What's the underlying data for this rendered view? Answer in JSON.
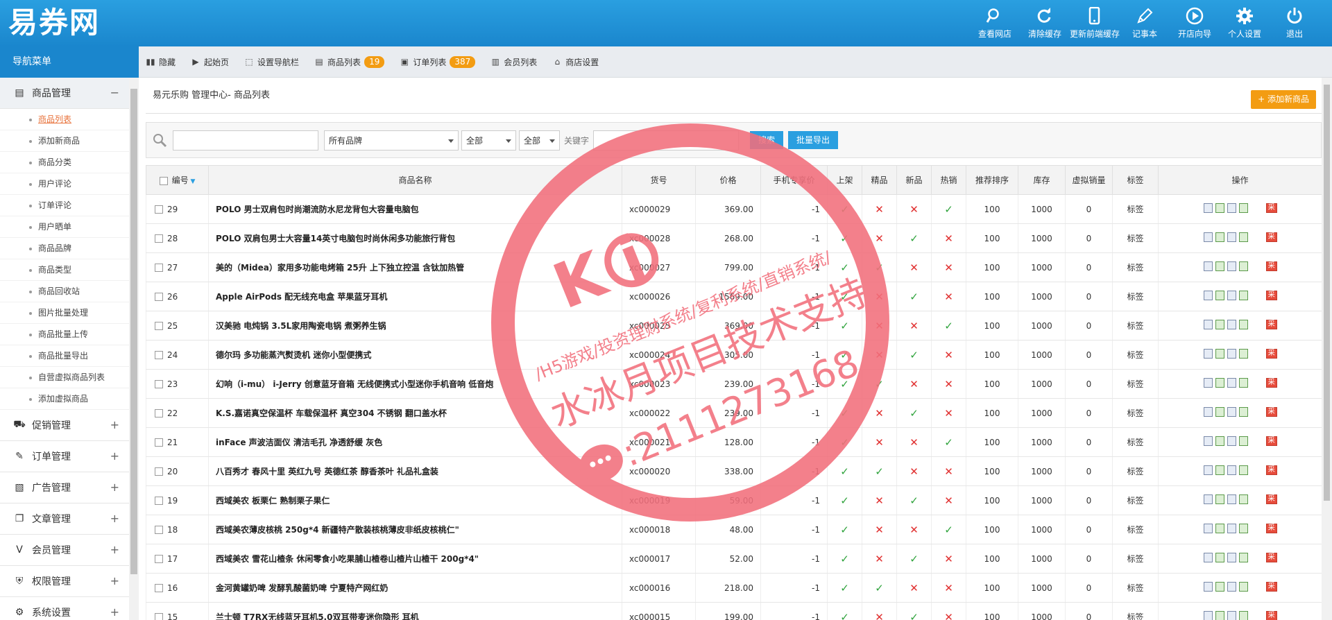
{
  "header": {
    "logo": "易券网",
    "nav": [
      {
        "label": "查看网店",
        "icon": "search-icon"
      },
      {
        "label": "清除缓存",
        "icon": "refresh-icon"
      },
      {
        "label": "更新前端缓存",
        "icon": "mobile-icon"
      },
      {
        "label": "记事本",
        "icon": "pen-icon"
      },
      {
        "label": "开店向导",
        "icon": "play-icon"
      },
      {
        "label": "个人设置",
        "icon": "gear-icon"
      },
      {
        "label": "退出",
        "icon": "power-icon"
      }
    ]
  },
  "sidebar": {
    "title": "导航菜单",
    "groups": [
      {
        "label": "商品管理",
        "open": true,
        "icon": "document-icon"
      },
      {
        "label": "促销管理",
        "icon": "cart-icon"
      },
      {
        "label": "订单管理",
        "icon": "edit-icon"
      },
      {
        "label": "广告管理",
        "icon": "image-icon"
      },
      {
        "label": "文章管理",
        "icon": "copy-icon"
      },
      {
        "label": "会员管理",
        "icon": "vip-icon"
      },
      {
        "label": "权限管理",
        "icon": "shield-icon"
      },
      {
        "label": "系统设置",
        "icon": "settings-icon"
      }
    ],
    "items": [
      "商品列表",
      "添加新商品",
      "商品分类",
      "用户评论",
      "订单评论",
      "用户晒单",
      "商品品牌",
      "商品类型",
      "商品回收站",
      "图片批量处理",
      "商品批量上传",
      "商品批量导出",
      "自营虚拟商品列表",
      "添加虚拟商品"
    ]
  },
  "toolbar": [
    {
      "label": "隐藏",
      "icon": "bars-icon"
    },
    {
      "label": "起始页",
      "icon": "play-circle-icon"
    },
    {
      "label": "设置导航栏",
      "icon": "external-icon"
    },
    {
      "label": "商品列表",
      "icon": "list-icon",
      "badge": "19"
    },
    {
      "label": "订单列表",
      "icon": "clipboard-icon",
      "badge": "387"
    },
    {
      "label": "会员列表",
      "icon": "member-icon"
    },
    {
      "label": "商店设置",
      "icon": "store-icon"
    }
  ],
  "main": {
    "breadcrumb": "易元乐购 管理中心- 商品列表",
    "add_button": "+ 添加新商品"
  },
  "filter": {
    "brand": "所有品牌",
    "cat1": "全部",
    "cat2": "全部",
    "keyword_label": "关键字",
    "search_btn": "搜索",
    "export_btn": "批量导出"
  },
  "table": {
    "headers": [
      "编号",
      "商品名称",
      "货号",
      "价格",
      "手机专享价",
      "上架",
      "精品",
      "新品",
      "热销",
      "推荐排序",
      "库存",
      "虚拟销量",
      "标签",
      "操作"
    ],
    "rows": [
      {
        "id": "29",
        "name": "POLO 男士双肩包时尚潮流防水尼龙背包大容量电脑包",
        "sn": "xc000029",
        "price": "369.00",
        "mp": "-1",
        "flags": [
          1,
          0,
          0,
          1
        ],
        "sort": "100",
        "stock": "1000",
        "vs": "0",
        "tag": "标签"
      },
      {
        "id": "28",
        "name": "POLO 双肩包男士大容量14英寸电脑包时尚休闲多功能旅行背包",
        "sn": "xc000028",
        "price": "268.00",
        "mp": "-1",
        "flags": [
          1,
          0,
          1,
          0
        ],
        "sort": "100",
        "stock": "1000",
        "vs": "0",
        "tag": "标签"
      },
      {
        "id": "27",
        "name": "美的（Midea）家用多功能电烤箱 25升 上下独立控温 含钛加热管",
        "sn": "xc000027",
        "price": "799.00",
        "mp": "-1",
        "flags": [
          1,
          1,
          0,
          0
        ],
        "sort": "100",
        "stock": "1000",
        "vs": "0",
        "tag": "标签"
      },
      {
        "id": "26",
        "name": "Apple AirPods 配无线充电盒 苹果蓝牙耳机",
        "sn": "xc000026",
        "price": "1569.00",
        "mp": "-1",
        "flags": [
          1,
          0,
          1,
          0
        ],
        "sort": "100",
        "stock": "1000",
        "vs": "0",
        "tag": "标签"
      },
      {
        "id": "25",
        "name": "汉美驰 电炖锅 3.5L家用陶瓷电锅 煮粥养生锅",
        "sn": "xc000025",
        "price": "369.00",
        "mp": "-1",
        "flags": [
          1,
          0,
          0,
          1
        ],
        "sort": "100",
        "stock": "1000",
        "vs": "0",
        "tag": "标签"
      },
      {
        "id": "24",
        "name": "德尔玛 多功能蒸汽熨烫机 迷你小型便携式",
        "sn": "xc000024",
        "price": "305.00",
        "mp": "-1",
        "flags": [
          1,
          0,
          1,
          0
        ],
        "sort": "100",
        "stock": "1000",
        "vs": "0",
        "tag": "标签"
      },
      {
        "id": "23",
        "name": "幻响（i-mu） i-Jerry 创意蓝牙音箱 无线便携式小型迷你手机音响 低音炮",
        "sn": "xc000023",
        "price": "239.00",
        "mp": "-1",
        "flags": [
          1,
          1,
          0,
          0
        ],
        "sort": "100",
        "stock": "1000",
        "vs": "0",
        "tag": "标签"
      },
      {
        "id": "22",
        "name": "K.S.嘉诺真空保温杯 车载保温杯 真空304 不锈钢 翻口盖水杯",
        "sn": "xc000022",
        "price": "239.00",
        "mp": "-1",
        "flags": [
          1,
          0,
          1,
          0
        ],
        "sort": "100",
        "stock": "1000",
        "vs": "0",
        "tag": "标签"
      },
      {
        "id": "21",
        "name": "inFace 声波洁面仪 清洁毛孔 净透舒缓 灰色",
        "sn": "xc000021",
        "price": "128.00",
        "mp": "-1",
        "flags": [
          1,
          0,
          0,
          1
        ],
        "sort": "100",
        "stock": "1000",
        "vs": "0",
        "tag": "标签"
      },
      {
        "id": "20",
        "name": "八百秀才 春风十里 英红九号 英德红茶 醇香茶叶 礼品礼盒装",
        "sn": "xc000020",
        "price": "338.00",
        "mp": "-1",
        "flags": [
          1,
          1,
          0,
          0
        ],
        "sort": "100",
        "stock": "1000",
        "vs": "0",
        "tag": "标签"
      },
      {
        "id": "19",
        "name": "西域美农 板栗仁 熟制栗子果仁",
        "sn": "xc000019",
        "price": "59.00",
        "mp": "-1",
        "flags": [
          1,
          0,
          1,
          0
        ],
        "sort": "100",
        "stock": "1000",
        "vs": "0",
        "tag": "标签"
      },
      {
        "id": "18",
        "name": "西域美农薄皮核桃 250g*4 新疆特产散装核桃薄皮非纸皮核桃仁\"",
        "sn": "xc000018",
        "price": "48.00",
        "mp": "-1",
        "flags": [
          1,
          0,
          0,
          1
        ],
        "sort": "100",
        "stock": "1000",
        "vs": "0",
        "tag": "标签"
      },
      {
        "id": "17",
        "name": "西域美农 雪花山楂条 休闲零食小吃果脯山楂卷山楂片山楂干 200g*4\"",
        "sn": "xc000017",
        "price": "52.00",
        "mp": "-1",
        "flags": [
          1,
          0,
          1,
          0
        ],
        "sort": "100",
        "stock": "1000",
        "vs": "0",
        "tag": "标签"
      },
      {
        "id": "16",
        "name": "金河黄罐奶啤 发酵乳酸菌奶啤 宁夏特产网红奶",
        "sn": "xc000016",
        "price": "218.00",
        "mp": "-1",
        "flags": [
          1,
          1,
          0,
          0
        ],
        "sort": "100",
        "stock": "1000",
        "vs": "0",
        "tag": "标签"
      },
      {
        "id": "15",
        "name": "兰士顿 T7RX无线蓝牙耳机5.0双耳带麦迷你隐形 耳机",
        "sn": "xc000015",
        "price": "199.00",
        "mp": "-1",
        "flags": [
          1,
          0,
          1,
          0
        ],
        "sort": "100",
        "stock": "1000",
        "vs": "0",
        "tag": "标签"
      }
    ]
  },
  "stamp": {
    "logo": "K i",
    "line1": "/H5游戏/投资理财系统/复利系统/直销系统/",
    "line2": "水冰月项目技术支持",
    "line3": ":2111273168"
  },
  "colors": {
    "header": "#1a86cd",
    "accent": "#f39c12",
    "stamp": "#f26f7c",
    "ok": "#2fa33c",
    "no": "#e03030"
  }
}
